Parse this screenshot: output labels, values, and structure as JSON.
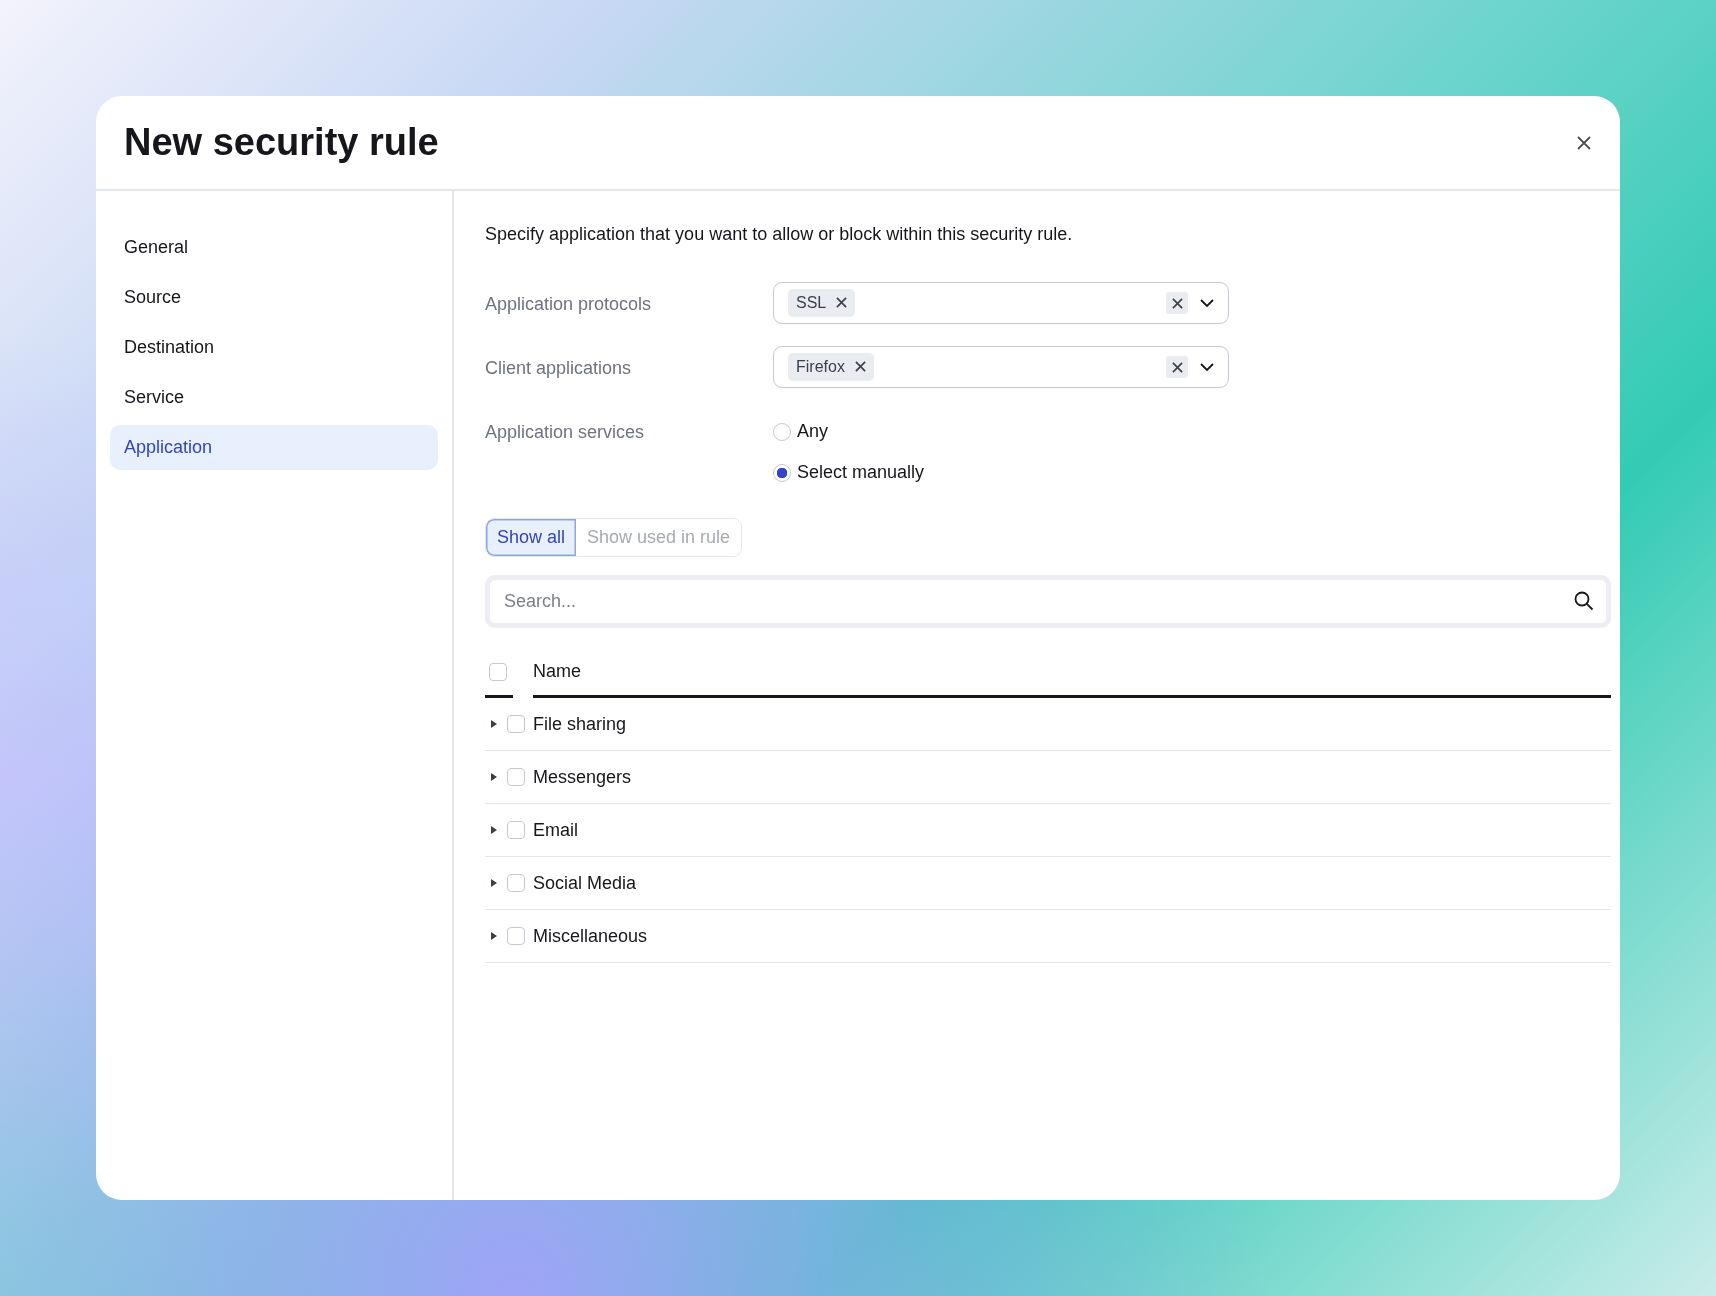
{
  "dialog": {
    "title": "New security rule"
  },
  "sidebar": {
    "items": [
      {
        "label": "General",
        "selected": false
      },
      {
        "label": "Source",
        "selected": false
      },
      {
        "label": "Destination",
        "selected": false
      },
      {
        "label": "Service",
        "selected": false
      },
      {
        "label": "Application",
        "selected": true
      }
    ]
  },
  "description": "Specify application that you want to allow or block within this security rule.",
  "fields": [
    {
      "kind": "multiselect",
      "label": "Application protocols",
      "tags": [
        "SSL"
      ]
    },
    {
      "kind": "multiselect",
      "label": "Client applications",
      "tags": [
        "Firefox"
      ]
    },
    {
      "kind": "radio",
      "label": "Application services",
      "options": [
        {
          "label": "Any",
          "selected": false
        },
        {
          "label": "Select manually",
          "selected": true
        }
      ]
    }
  ],
  "filter_tabs": [
    {
      "label": "Show all",
      "selected": true
    },
    {
      "label": "Show used in rule",
      "selected": false
    }
  ],
  "search": {
    "placeholder": "Search..."
  },
  "table": {
    "header_checked": false,
    "columns": [
      "Name"
    ],
    "rows": [
      {
        "name": "File sharing",
        "checked": false,
        "expanded": false
      },
      {
        "name": "Messengers",
        "checked": false,
        "expanded": false
      },
      {
        "name": "Email",
        "checked": false,
        "expanded": false
      },
      {
        "name": "Social Media",
        "checked": false,
        "expanded": false
      },
      {
        "name": "Miscellaneous",
        "checked": false,
        "expanded": false
      }
    ]
  }
}
